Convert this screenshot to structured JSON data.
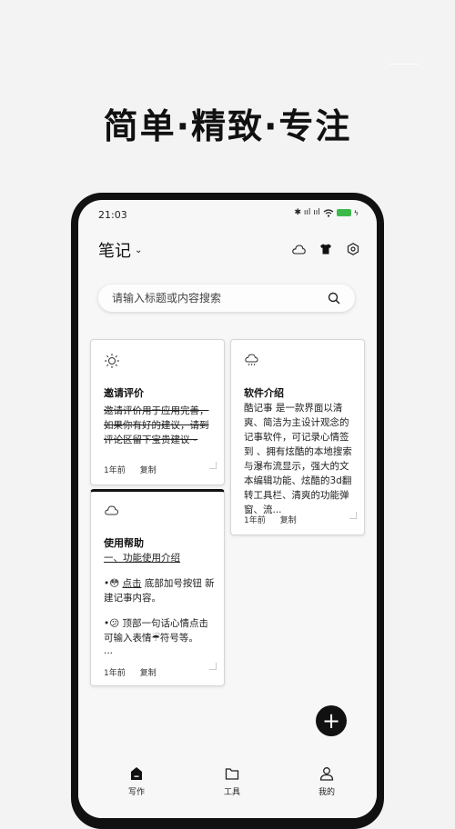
{
  "headline": "简单·精致·专注",
  "status_bar": {
    "time": "21:03",
    "signal_text": "✱ ııl ııl",
    "battery_color": "#3db94a"
  },
  "header": {
    "title": "笔记",
    "icons": [
      "cloud-icon",
      "tshirt-icon",
      "settings-icon"
    ]
  },
  "search": {
    "placeholder": "请输入标题或内容搜索",
    "icon": "search-icon"
  },
  "notes": [
    {
      "icon": "sun-icon",
      "title": "邀请评价",
      "body": "邀请评价用于应用完善，如果你有好的建议，请到评论区留下宝贵建议~",
      "struck": true,
      "time": "1年前",
      "action": "复制"
    },
    {
      "icon": "rain-cloud-icon",
      "title": "软件介绍",
      "body": "酷记事 是一款界面以清爽、简洁为主设计观念的记事软件，可记录心情签到 、拥有炫酷的本地搜索与瀑布流显示，强大的文本编辑功能、炫酷的3d翻转工具栏、清爽的功能弹窗、流...",
      "struck": false,
      "time": "1年前",
      "action": "复制"
    },
    {
      "icon": "cloud-icon",
      "title": "使用帮助",
      "subtitle": "一、功能使用介绍",
      "line1_prefix": "•😳 ",
      "line1_link": "点击",
      "line1_rest": " 底部加号按钮 新建记事内容。",
      "line2": "•😕 顶部一句话心情点击可输入表情☔符号等。",
      "ellipsis": "...",
      "time": "1年前",
      "action": "复制"
    }
  ],
  "fab": {
    "label": "+"
  },
  "bottom_nav": [
    {
      "label": "写作",
      "icon": "home-icon",
      "active": true
    },
    {
      "label": "工具",
      "icon": "folder-icon",
      "active": false
    },
    {
      "label": "我的",
      "icon": "person-icon",
      "active": false
    }
  ]
}
